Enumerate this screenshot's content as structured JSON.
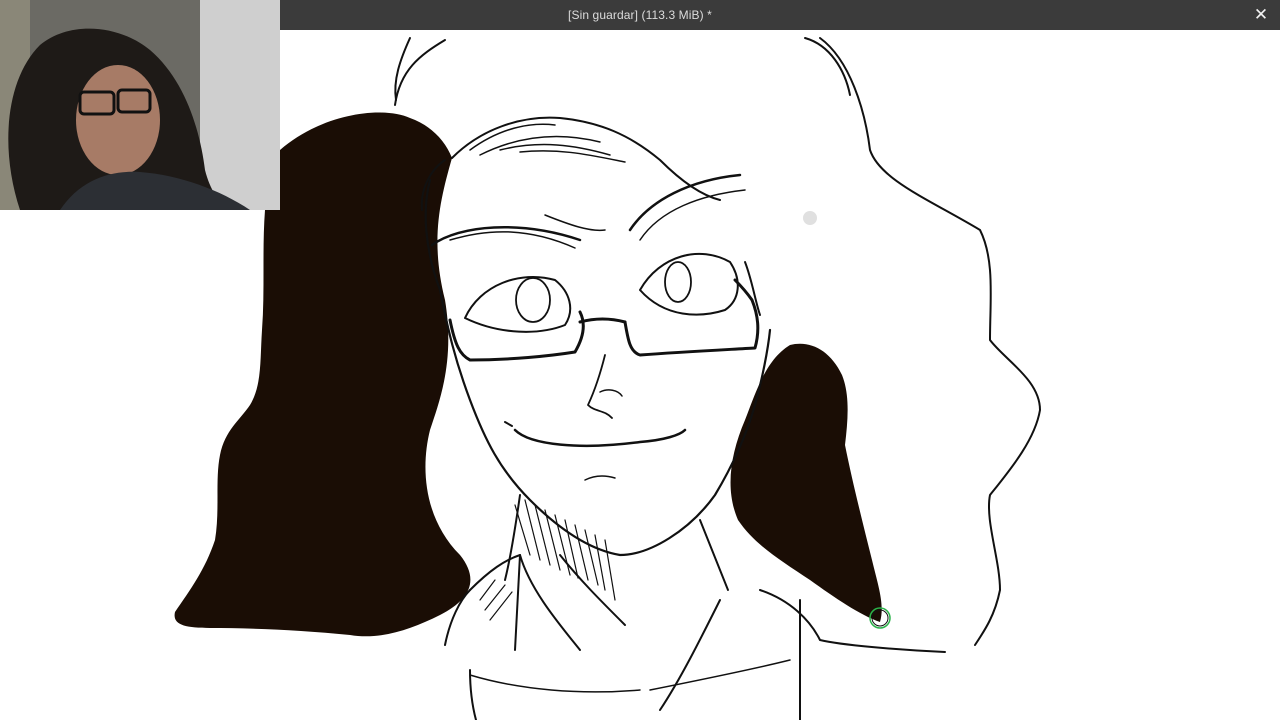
{
  "window": {
    "title": "[Sin guardar]  (113.3 MiB) *",
    "close_icon": "close-icon",
    "close_glyph": "✕"
  },
  "canvas": {
    "background": "#ffffff",
    "fill_color": "#1a0d05",
    "brush_cursor_color": "#2bb34a"
  },
  "webcam": {
    "icon": "webcam-overlay"
  }
}
